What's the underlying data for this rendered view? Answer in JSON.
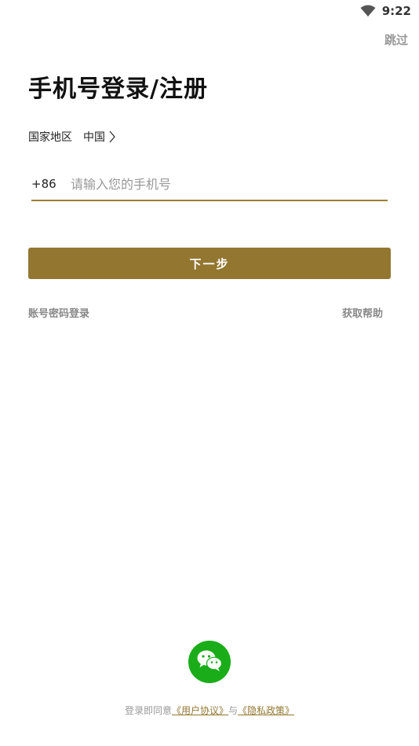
{
  "status_bar": {
    "time": "9:22",
    "wifi_icon": "wifi-icon"
  },
  "header": {
    "skip_label": "跳过",
    "title": "手机号登录/注册"
  },
  "region": {
    "label": "国家地区",
    "value": "中国",
    "chevron_icon": "chevron-right-icon"
  },
  "phone": {
    "country_code": "+86",
    "placeholder": "请输入您的手机号",
    "value": ""
  },
  "actions": {
    "next_label": "下一步",
    "password_login_label": "账号密码登录",
    "help_label": "获取帮助"
  },
  "footer": {
    "wechat_icon": "wechat-icon",
    "agreement_prefix": "登录即同意",
    "user_agreement": "《用户协议》",
    "connector": "与",
    "privacy_policy": "《隐私政策》"
  },
  "colors": {
    "accent": "#937731",
    "underline": "#9b7f35",
    "wechat_green": "#1aad19",
    "muted_text": "#999999"
  }
}
